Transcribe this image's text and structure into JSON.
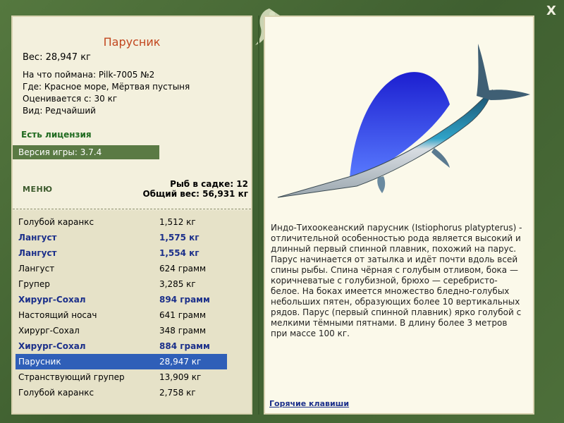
{
  "window": {
    "close_label": "X"
  },
  "fish": {
    "title": "Парусник",
    "weight": "Вес: 28,947 кг",
    "caught_with": "На что поймана: Pilk-7005 №2",
    "where": "Где: Красное море, Мёртвая пустыня",
    "estimated": "Оценивается с: 30 кг",
    "kind": "Вид: Редчайший",
    "description": "Индо-Тихоокеанский парусник (Istiophorus platypterus) - отличительной особенностью рода является высокий и длинный первый спинной плавник, похожий на парус. Парус начинается от затылка и идёт почти вдоль всей спины рыбы. Спина чёрная с голубым отливом, бока — коричневатые с голубизной, брюхо — серебристо-белое. На боках имеется множество бледно-голубых небольших пятен, образующих более 10 вертикальных рядов. Парус (первый спинной плавник) ярко голубой с мелкими тёмными пятнами. В длину более 3 метров при массе 100 кг."
  },
  "license": "Есть лицензия",
  "version": "Версия игры: 3.7.4",
  "menu_label": "МЕНЮ",
  "cage": {
    "count": "Рыб в садке: 12",
    "total": "Общий вес: 56,931 кг"
  },
  "list": [
    {
      "name": "Голубой каранкс",
      "weight": "1,512 кг",
      "style": "normal"
    },
    {
      "name": "Лангуст",
      "weight": "1,575 кг",
      "style": "bold"
    },
    {
      "name": "Лангуст",
      "weight": "1,554 кг",
      "style": "bold"
    },
    {
      "name": "Лангуст",
      "weight": "624 грамм",
      "style": "normal"
    },
    {
      "name": "Групер",
      "weight": "3,285 кг",
      "style": "normal"
    },
    {
      "name": "Хирург-Сохал",
      "weight": "894 грамм",
      "style": "bold"
    },
    {
      "name": "Настоящий носач",
      "weight": "641 грамм",
      "style": "normal"
    },
    {
      "name": "Хирург-Сохал",
      "weight": "348 грамм",
      "style": "normal"
    },
    {
      "name": "Хирург-Сохал",
      "weight": "884 грамм",
      "style": "bold"
    },
    {
      "name": "Парусник",
      "weight": "28,947 кг",
      "style": "selected"
    },
    {
      "name": "Странствующий групер",
      "weight": "13,909 кг",
      "style": "normal"
    },
    {
      "name": "Голубой каранкс",
      "weight": "2,758 кг",
      "style": "normal"
    }
  ],
  "hotkeys_label": "Горячие клавиши",
  "colors": {
    "accent": "#c2461e",
    "selected": "#2f5fb8",
    "bold_text": "#1b2f8a",
    "frame": "#4a6a3a"
  }
}
